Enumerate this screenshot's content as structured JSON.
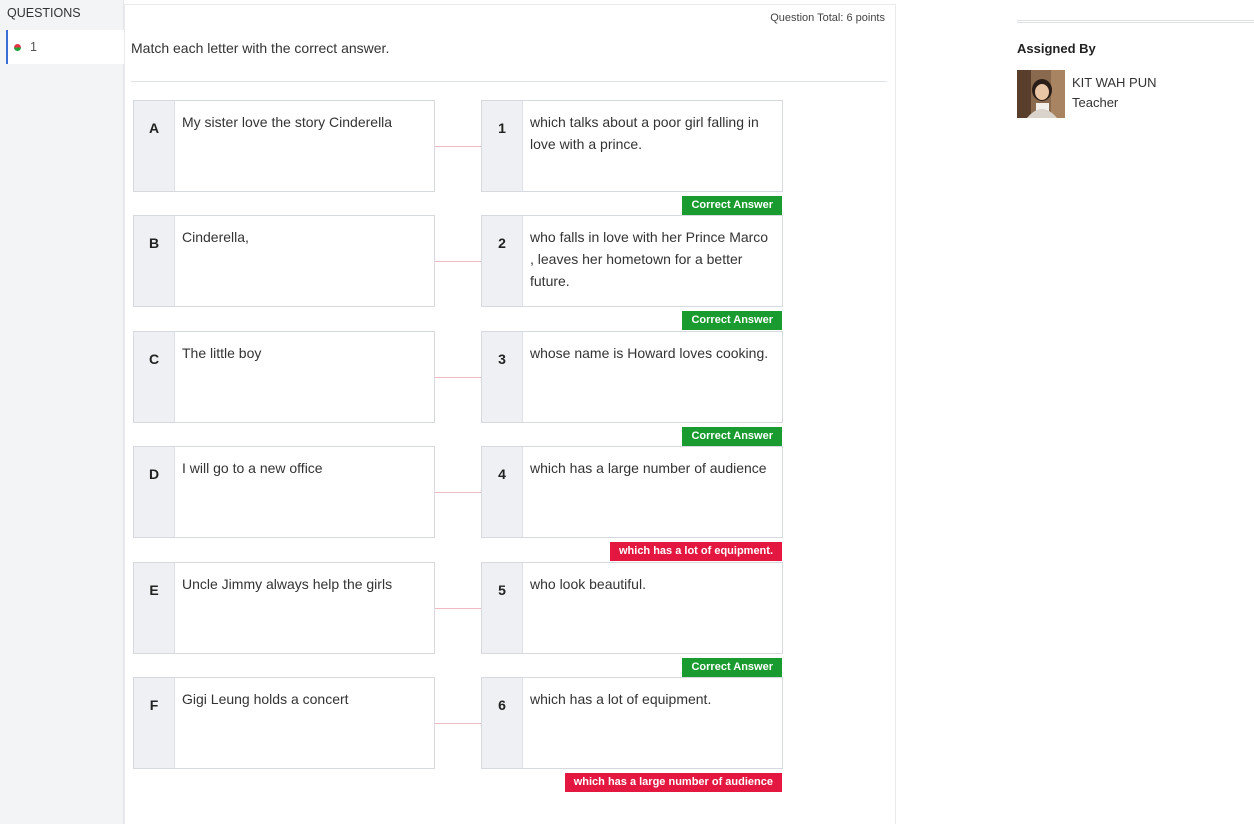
{
  "rail": {
    "header": "QUESTIONS",
    "items": [
      {
        "label": "1"
      }
    ]
  },
  "question": {
    "total": "Question Total: 6 points",
    "prompt": "Match each letter with the correct answer.",
    "pairs": [
      {
        "letter": "A",
        "left": "My sister love the story Cinderella",
        "number": "1",
        "right": "which talks about a poor girl falling in love with a prince.",
        "result": "Correct Answer",
        "correct": true
      },
      {
        "letter": "B",
        "left": "Cinderella,",
        "number": "2",
        "right": "who falls in love with her Prince Marco , leaves her hometown for a better future.",
        "result": "Correct Answer",
        "correct": true
      },
      {
        "letter": "C",
        "left": "The little boy",
        "number": "3",
        "right": "whose name is Howard loves cooking.",
        "result": "Correct Answer",
        "correct": true
      },
      {
        "letter": "D",
        "left": "I will go to a new office",
        "number": "4",
        "right": "which has a large number of audience",
        "result": "which has a lot of equipment.",
        "correct": false
      },
      {
        "letter": "E",
        "left": "Uncle Jimmy always help the girls",
        "number": "5",
        "right": "who look beautiful.",
        "result": "Correct Answer",
        "correct": true
      },
      {
        "letter": "F",
        "left": "Gigi Leung holds a concert",
        "number": "6",
        "right": "which has a lot of equipment.",
        "result": "which has a large number of audience",
        "correct": false
      }
    ]
  },
  "sidebar": {
    "assigned_label": "Assigned By",
    "teacher_name": "KIT WAH PUN",
    "teacher_role": "Teacher"
  },
  "colors": {
    "correct": "#1a9b2f",
    "incorrect": "#e3173f",
    "accent": "#3b6fd6"
  }
}
